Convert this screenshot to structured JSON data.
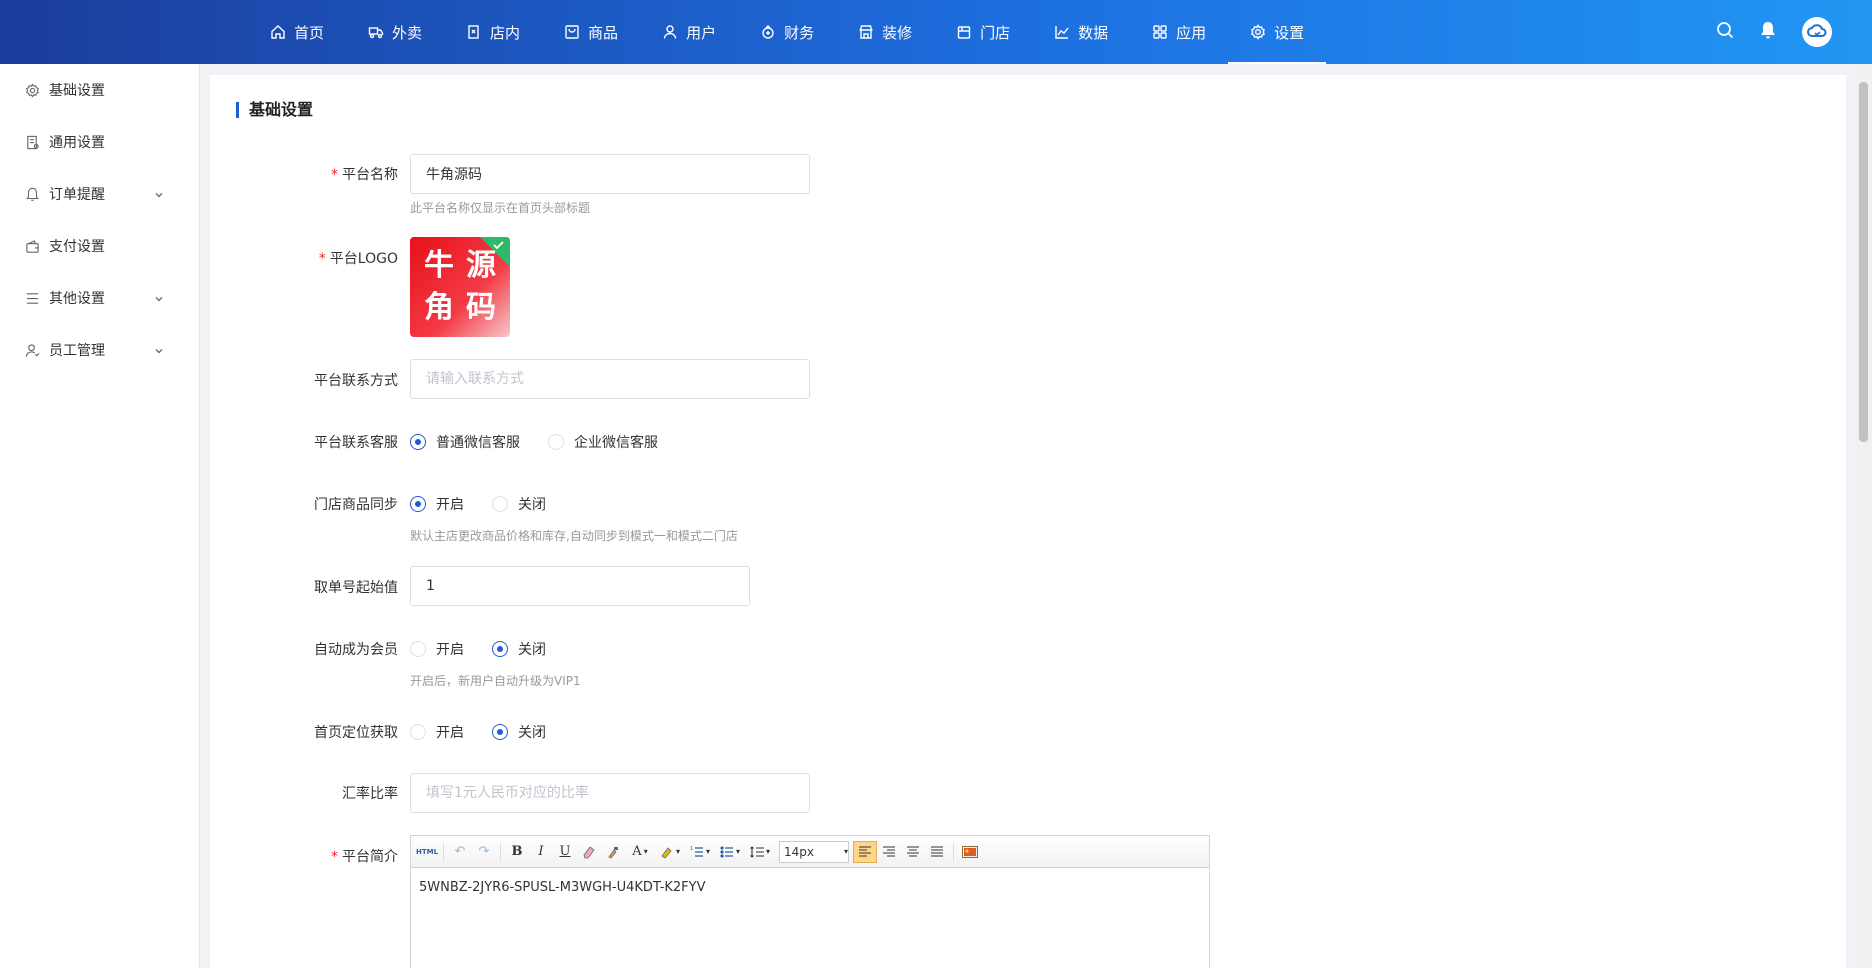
{
  "nav": {
    "items": [
      {
        "label": "首页",
        "icon": "home-icon"
      },
      {
        "label": "外卖",
        "icon": "delivery-icon"
      },
      {
        "label": "店内",
        "icon": "dine-in-icon"
      },
      {
        "label": "商品",
        "icon": "goods-icon"
      },
      {
        "label": "用户",
        "icon": "user-icon"
      },
      {
        "label": "财务",
        "icon": "finance-icon"
      },
      {
        "label": "装修",
        "icon": "decorate-icon"
      },
      {
        "label": "门店",
        "icon": "store-icon"
      },
      {
        "label": "数据",
        "icon": "chart-icon"
      },
      {
        "label": "应用",
        "icon": "apps-icon"
      },
      {
        "label": "设置",
        "icon": "gear-icon"
      }
    ],
    "active_index": 10
  },
  "sidebar": {
    "items": [
      {
        "label": "基础设置",
        "icon": "settings-icon",
        "expandable": false
      },
      {
        "label": "通用设置",
        "icon": "document-icon",
        "expandable": false
      },
      {
        "label": "订单提醒",
        "icon": "bell-icon",
        "expandable": true
      },
      {
        "label": "支付设置",
        "icon": "wallet-icon",
        "expandable": false
      },
      {
        "label": "其他设置",
        "icon": "list-icon",
        "expandable": true
      },
      {
        "label": "员工管理",
        "icon": "staff-icon",
        "expandable": true
      }
    ]
  },
  "section": {
    "title": "基础设置"
  },
  "form": {
    "platform_name": {
      "label": "平台名称",
      "required": true,
      "value": "牛角源码",
      "hint": "此平台名称仅显示在首页头部标题"
    },
    "platform_logo": {
      "label": "平台LOGO",
      "required": true,
      "logo_chars": [
        "牛",
        "源",
        "角",
        "码"
      ]
    },
    "contact": {
      "label": "平台联系方式",
      "placeholder": "请输入联系方式"
    },
    "customer_service": {
      "label": "平台联系客服",
      "options": [
        "普通微信客服",
        "企业微信客服"
      ],
      "selected": 0
    },
    "store_sync": {
      "label": "门店商品同步",
      "options": [
        "开启",
        "关闭"
      ],
      "selected": 0,
      "hint": "默认主店更改商品价格和库存,自动同步到模式一和模式二门店"
    },
    "order_start": {
      "label": "取单号起始值",
      "value": "1"
    },
    "auto_member": {
      "label": "自动成为会员",
      "options": [
        "开启",
        "关闭"
      ],
      "selected": 1,
      "hint": "开启后，新用户自动升级为VIP1"
    },
    "home_location": {
      "label": "首页定位获取",
      "options": [
        "开启",
        "关闭"
      ],
      "selected": 1
    },
    "exchange_rate": {
      "label": "汇率比率",
      "placeholder": "填写1元人民币对应的比率"
    },
    "intro": {
      "label": "平台简介",
      "required": true,
      "content": "5WNBZ-2JYR6-SPUSL-M3WGH-U4KDT-K2FYV",
      "font_size": "14px",
      "html_label": "HTML"
    }
  },
  "colors": {
    "accent": "#1e5bd8",
    "nav_start": "#1c3d9c",
    "nav_end": "#2196f3",
    "required": "#f5222d"
  }
}
